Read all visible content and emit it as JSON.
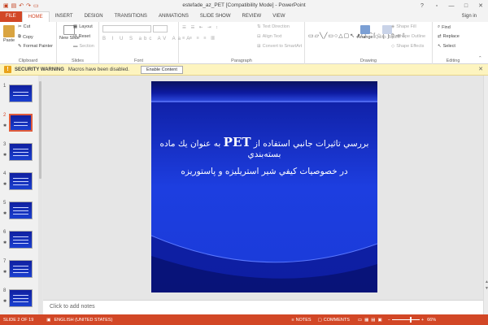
{
  "window": {
    "title": "estefade_az_PET [Compatibility Mode] - PowerPoint",
    "sign_in": "Sign in"
  },
  "ribbon": {
    "tabs": [
      {
        "label": "FILE"
      },
      {
        "label": "HOME"
      },
      {
        "label": "INSERT"
      },
      {
        "label": "DESIGN"
      },
      {
        "label": "TRANSITIONS"
      },
      {
        "label": "ANIMATIONS"
      },
      {
        "label": "SLIDE SHOW"
      },
      {
        "label": "REVIEW"
      },
      {
        "label": "VIEW"
      }
    ],
    "clipboard": {
      "label": "Clipboard",
      "paste": "Paste",
      "cut": "Cut",
      "copy": "Copy",
      "format_painter": "Format Painter"
    },
    "slides": {
      "label": "Slides",
      "new_slide": "New Slide",
      "layout": "Layout",
      "reset": "Reset",
      "section": "Section"
    },
    "font": {
      "label": "Font"
    },
    "paragraph": {
      "label": "Paragraph",
      "text_direction": "Text Direction",
      "align_text": "Align Text",
      "convert_smartart": "Convert to SmartArt"
    },
    "drawing": {
      "label": "Drawing",
      "arrange": "Arrange",
      "quick_styles": "Quick Styles",
      "shape_fill": "Shape Fill",
      "shape_outline": "Shape Outline",
      "shape_effects": "Shape Effects"
    },
    "editing": {
      "label": "Editing",
      "find": "Find",
      "replace": "Replace",
      "select": "Select"
    }
  },
  "security_bar": {
    "title": "SECURITY WARNING",
    "message": "Macros have been disabled.",
    "button": "Enable Content"
  },
  "thumbnails": [
    {
      "num": "1",
      "star": false,
      "selected": false
    },
    {
      "num": "2",
      "star": true,
      "selected": true
    },
    {
      "num": "3",
      "star": true,
      "selected": false
    },
    {
      "num": "4",
      "star": true,
      "selected": false
    },
    {
      "num": "5",
      "star": true,
      "selected": false
    },
    {
      "num": "6",
      "star": true,
      "selected": false
    },
    {
      "num": "7",
      "star": true,
      "selected": false
    },
    {
      "num": "8",
      "star": true,
      "selected": false
    }
  ],
  "slide": {
    "line1_pre": "بررسي تاثيرات جانبي استفاده از",
    "line1_bold": "PET",
    "line1_post": "به عنوان يك ماده بسته‌بندي",
    "line2": "در خصوصيات كيفي شير استريليزه و پاستوريزه"
  },
  "notes": {
    "placeholder": "Click to add notes"
  },
  "status": {
    "slide_info": "SLIDE 2 OF 19",
    "language": "ENGLISH (UNITED STATES)",
    "notes": "NOTES",
    "comments": "COMMENTS",
    "zoom": "66%"
  },
  "colors": {
    "accent": "#d24726",
    "slide_bg": "#1a3bd8",
    "security_bar": "#fdf4bf"
  }
}
